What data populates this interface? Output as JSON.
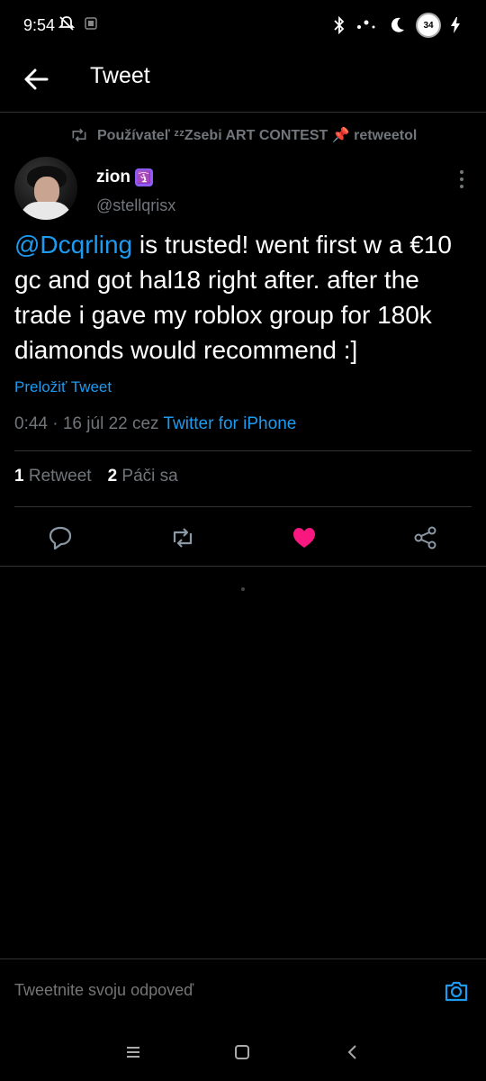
{
  "status": {
    "time": "9:54",
    "battery_text": "34"
  },
  "header": {
    "title": "Tweet"
  },
  "retweet": {
    "label": "Používateľ ᶻᶻZsebi ART CONTEST 📌 retweetol"
  },
  "author": {
    "name": "zion",
    "handle": "@stellqrisx",
    "badge_emoji": "🛐"
  },
  "tweet": {
    "mention": "@Dcqrling",
    "text": " is trusted! went first w a €10 gc and got hal18 right after. after the trade i gave my roblox group for 180k diamonds would recommend :]",
    "translate": "Preložiť Tweet",
    "time_date": "0:44 · 16 júl 22 cez ",
    "source": "Twitter for iPhone"
  },
  "stats": {
    "retweets_count": "1",
    "retweets_label": "Retweet",
    "likes_count": "2",
    "likes_label": "Páči sa"
  },
  "reply": {
    "placeholder": "Tweetnite svoju odpoveď"
  },
  "colors": {
    "accent": "#1d9bf0",
    "like": "#f91880",
    "background": "#000000",
    "muted": "#71767b"
  }
}
